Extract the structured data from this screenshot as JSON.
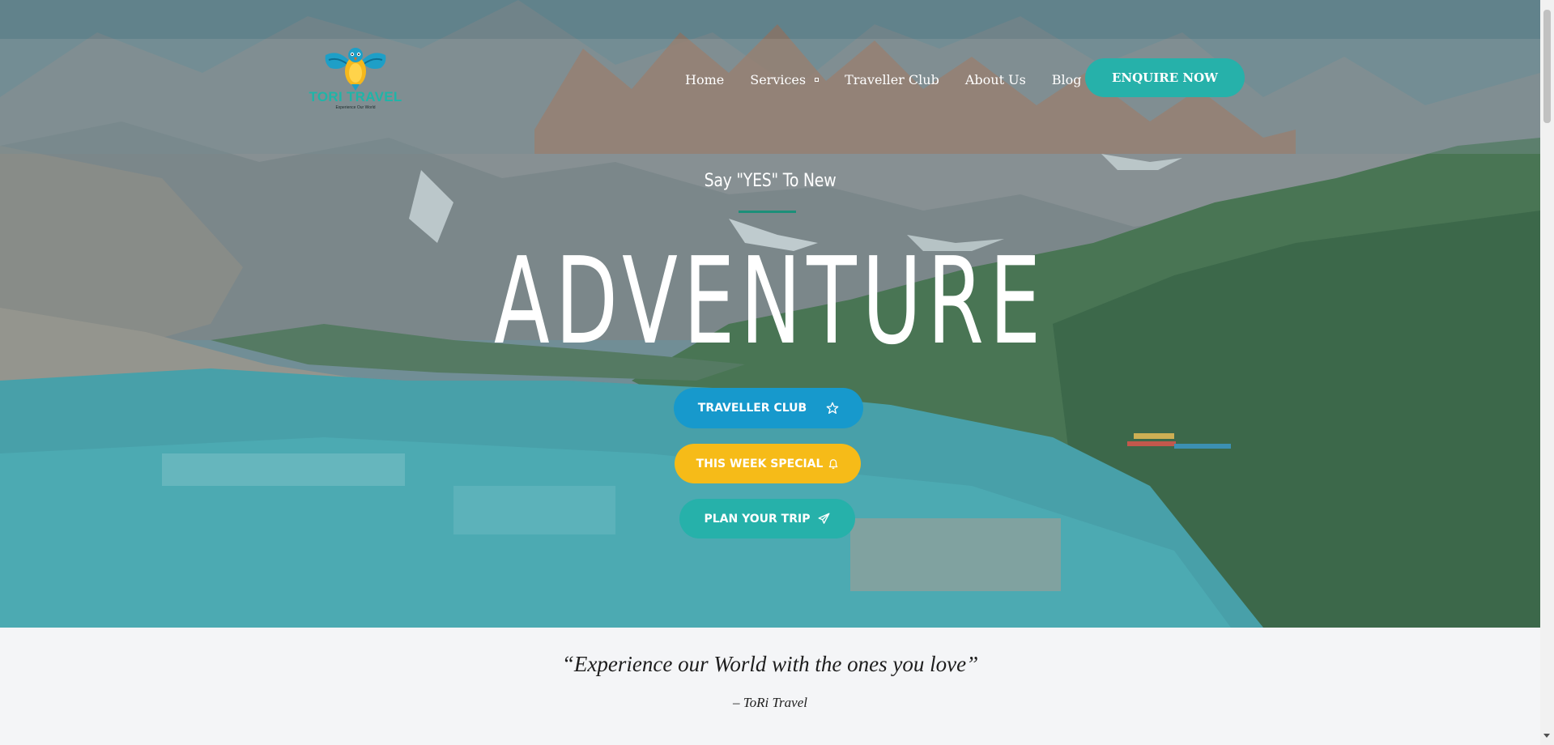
{
  "header": {
    "logo": {
      "brand": "TORI TRAVEL",
      "tagline": "Experience Our World",
      "icon": "bird-logo-icon"
    },
    "nav": [
      {
        "label": "Home",
        "has_dropdown": false
      },
      {
        "label": "Services",
        "has_dropdown": true
      },
      {
        "label": "Traveller Club",
        "has_dropdown": false
      },
      {
        "label": "About Us",
        "has_dropdown": false
      },
      {
        "label": "Blog",
        "has_dropdown": true
      }
    ],
    "cta_label": "ENQUIRE NOW"
  },
  "hero": {
    "kicker": "Say \"YES\" To New",
    "headline": "ADVENTURE",
    "buttons": [
      {
        "label": "TRAVELLER CLUB",
        "icon": "star-icon",
        "color": "#1799cc"
      },
      {
        "label": "THIS WEEK SPECIAL",
        "icon": "bell-icon",
        "color": "#f6bb18"
      },
      {
        "label": "PLAN YOUR TRIP",
        "icon": "paper-plane-icon",
        "color": "#26b1aa"
      }
    ]
  },
  "quote": {
    "text": "“Experience our World with the ones you love”",
    "author": "– ToRi Travel"
  },
  "colors": {
    "accent": "#26b1aa",
    "blue": "#1799cc",
    "yellow": "#f6bb18",
    "kicker_underline": "#1c8f79"
  }
}
